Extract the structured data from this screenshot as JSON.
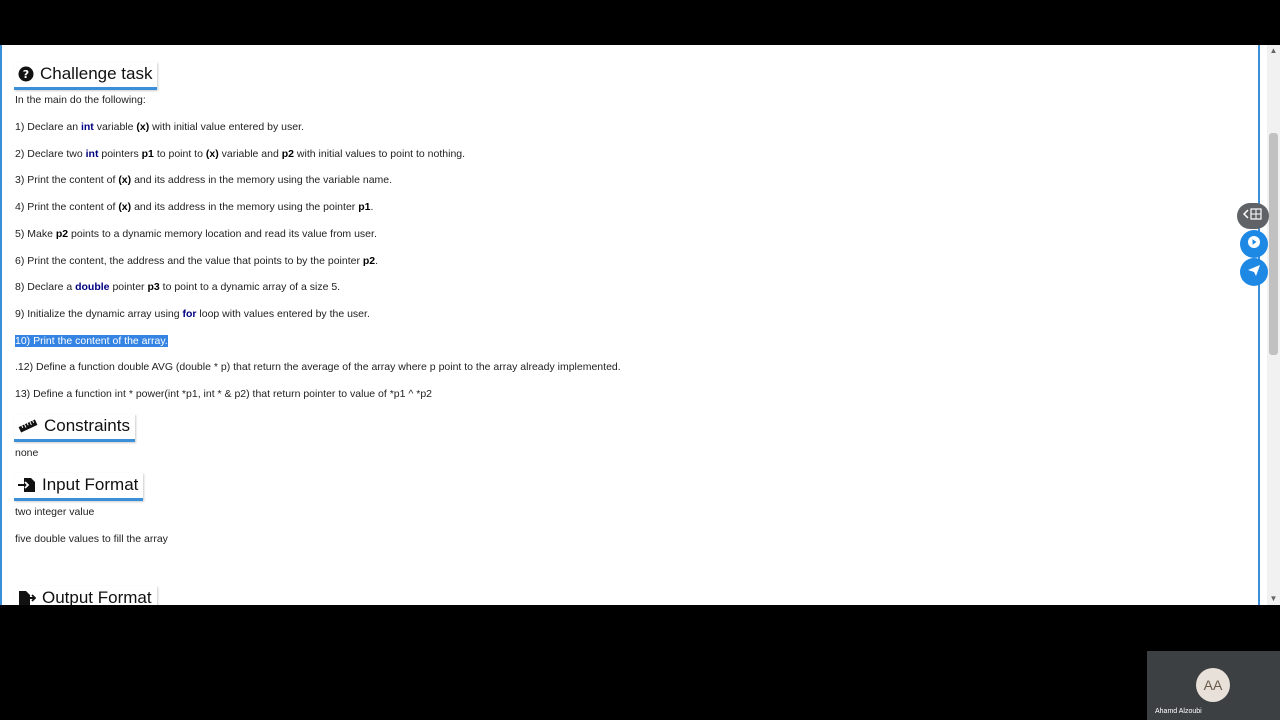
{
  "challenge": {
    "title": "Challenge task",
    "intro": "In the main do the following:"
  },
  "steps": [
    {
      "parts": [
        {
          "t": "1) Declare an ",
          "s": "n"
        },
        {
          "t": "int",
          "s": "kw"
        },
        {
          "t": " variable ",
          "s": "n"
        },
        {
          "t": "(x)",
          "s": "b"
        },
        {
          "t": " with initial value entered by user.",
          "s": "n"
        }
      ]
    },
    {
      "parts": [
        {
          "t": "2) Declare two ",
          "s": "n"
        },
        {
          "t": "int",
          "s": "kw"
        },
        {
          "t": " pointers ",
          "s": "n"
        },
        {
          "t": "p1",
          "s": "b"
        },
        {
          "t": " to point to ",
          "s": "n"
        },
        {
          "t": "(x)",
          "s": "b"
        },
        {
          "t": " variable and ",
          "s": "n"
        },
        {
          "t": "p2",
          "s": "b"
        },
        {
          "t": " with initial values to point to nothing.",
          "s": "n"
        }
      ]
    },
    {
      "parts": [
        {
          "t": "3) Print the content of ",
          "s": "n"
        },
        {
          "t": "(x)",
          "s": "b"
        },
        {
          "t": " and its address in the memory using the variable name.",
          "s": "n"
        }
      ]
    },
    {
      "parts": [
        {
          "t": "4) Print the content of ",
          "s": "n"
        },
        {
          "t": "(x)",
          "s": "b"
        },
        {
          "t": " and its address in the memory using the pointer ",
          "s": "n"
        },
        {
          "t": "p1",
          "s": "b"
        },
        {
          "t": ".",
          "s": "n"
        }
      ]
    },
    {
      "parts": [
        {
          "t": "5) Make ",
          "s": "n"
        },
        {
          "t": "p2",
          "s": "b"
        },
        {
          "t": " points to a dynamic memory location and read its value from user.",
          "s": "n"
        }
      ]
    },
    {
      "parts": [
        {
          "t": "6) Print the content, the address and the value that points to by the pointer ",
          "s": "n"
        },
        {
          "t": "p2",
          "s": "b"
        },
        {
          "t": ".",
          "s": "n"
        }
      ]
    },
    {
      "parts": [
        {
          "t": "8) Declare a ",
          "s": "n"
        },
        {
          "t": "double",
          "s": "kw"
        },
        {
          "t": " pointer ",
          "s": "n"
        },
        {
          "t": "p3",
          "s": "b"
        },
        {
          "t": " to point to a dynamic array of a size 5.",
          "s": "n"
        }
      ]
    },
    {
      "parts": [
        {
          "t": "9) Initialize the dynamic array using ",
          "s": "n"
        },
        {
          "t": "for",
          "s": "kw"
        },
        {
          "t": " loop with values entered by the user.",
          "s": "n"
        }
      ]
    },
    {
      "parts": [
        {
          "t": "10) Print the content of the array.",
          "s": "hl"
        }
      ]
    },
    {
      "parts": [
        {
          "t": ".12) Define a function double AVG (double * p) that return the average of the array where p point to the array already implemented.",
          "s": "n"
        }
      ]
    },
    {
      "parts": [
        {
          "t": "13) Define a function int * power(int *p1, int * & p2) that return pointer to value of *p1 ^ *p2",
          "s": "n"
        }
      ]
    }
  ],
  "constraints": {
    "title": "Constraints",
    "text": "none"
  },
  "input_format": {
    "title": "Input Format",
    "lines": [
      "two integer value",
      "five double values to fill the array"
    ]
  },
  "output_format": {
    "title": "Output Format"
  },
  "participant": {
    "initials": "AA",
    "name": "Ahamd Alzoubi"
  },
  "icons": {
    "challenge": "question-circle-icon",
    "constraints": "ruler-icon",
    "input": "file-import-icon",
    "output": "file-export-icon",
    "expand": "expand-panel-icon",
    "play": "play-icon",
    "send": "send-icon"
  },
  "colors": {
    "keyword": "#000080",
    "accent": "#3a8fd8",
    "highlight": "#3584e4",
    "fab": "#1e88e5"
  }
}
